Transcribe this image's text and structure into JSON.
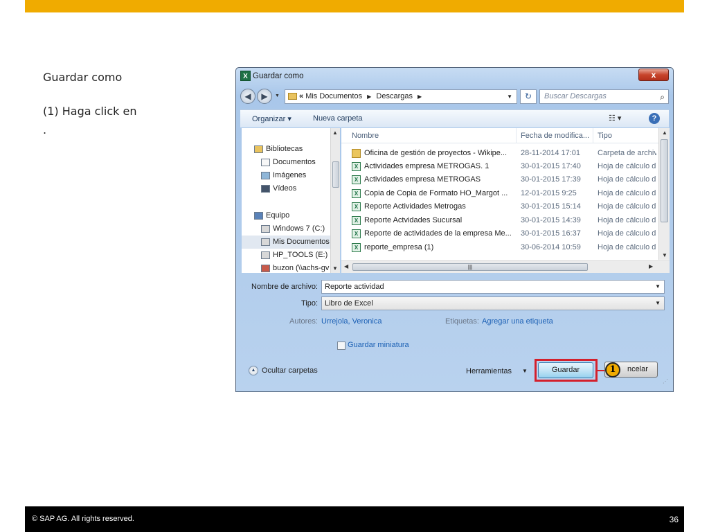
{
  "slide": {
    "title": "Guardar como",
    "step": "(1) Haga click en",
    "step_end": ".",
    "footer": "©  SAP AG. All rights reserved.",
    "page_number": "36"
  },
  "dialog": {
    "title": "Guardar como",
    "close": "x",
    "breadcrumb": [
      "Mis Documentos",
      "Descargas"
    ],
    "search_placeholder": "Buscar Descargas",
    "toolbar": {
      "organize": "Organizar ▾",
      "new_folder": "Nueva carpeta"
    },
    "nav_items": [
      {
        "label": "Bibliotecas",
        "icon": "libraries-icon"
      },
      {
        "label": "Documentos",
        "icon": "documents-icon"
      },
      {
        "label": "Imágenes",
        "icon": "pictures-icon"
      },
      {
        "label": "Vídeos",
        "icon": "videos-icon"
      },
      {
        "label": "Equipo",
        "icon": "computer-icon"
      },
      {
        "label": "Windows 7 (C:)",
        "icon": "drive-icon"
      },
      {
        "label": "Mis Documentos",
        "icon": "drive-icon"
      },
      {
        "label": "HP_TOOLS (E:)",
        "icon": "drive-icon"
      },
      {
        "label": "buzon (\\\\achs-gv",
        "icon": "network-drive-icon"
      }
    ],
    "columns": [
      "Nombre",
      "Fecha de modifica...",
      "Tipo"
    ],
    "files": [
      {
        "name": "Oficina de gestión de proyectos - Wikipe...",
        "date": "28-11-2014 17:01",
        "type": "Carpeta de archiv",
        "icon": "folder-icon"
      },
      {
        "name": "Actividades empresa METROGAS. 1",
        "date": "30-01-2015 17:40",
        "type": "Hoja de cálculo d",
        "icon": "excel-icon"
      },
      {
        "name": "Actividades empresa METROGAS",
        "date": "30-01-2015 17:39",
        "type": "Hoja de cálculo d",
        "icon": "excel-icon"
      },
      {
        "name": "Copia de Copia de Formato HO_Margot ...",
        "date": "12-01-2015 9:25",
        "type": "Hoja de cálculo d",
        "icon": "excel-icon"
      },
      {
        "name": "Reporte Actividades Metrogas",
        "date": "30-01-2015 15:14",
        "type": "Hoja de cálculo d",
        "icon": "excel-icon"
      },
      {
        "name": "Reporte Actvidades Sucursal",
        "date": "30-01-2015 14:39",
        "type": "Hoja de cálculo d",
        "icon": "excel-icon"
      },
      {
        "name": "Reporte de actividades de la empresa Me...",
        "date": "30-01-2015 16:37",
        "type": "Hoja de cálculo d",
        "icon": "excel-icon"
      },
      {
        "name": "reporte_empresa (1)",
        "date": "30-06-2014 10:59",
        "type": "Hoja de cálculo d",
        "icon": "excel-icon"
      }
    ],
    "form": {
      "filename_label": "Nombre de archivo:",
      "filename_value": "Reporte actividad",
      "type_label": "Tipo:",
      "type_value": "Libro de Excel",
      "authors_label": "Autores:",
      "authors_value": "Urrejola, Veronica",
      "tags_label": "Etiquetas:",
      "tags_value": "Agregar una etiqueta",
      "thumbnail_label": "Guardar miniatura",
      "hide_folders": "Ocultar carpetas",
      "tools": "Herramientas",
      "save": "Guardar",
      "cancel": "ncelar"
    },
    "callout_number": "1",
    "accent_color": "#f0ab00",
    "highlight_color": "#d4202c"
  }
}
